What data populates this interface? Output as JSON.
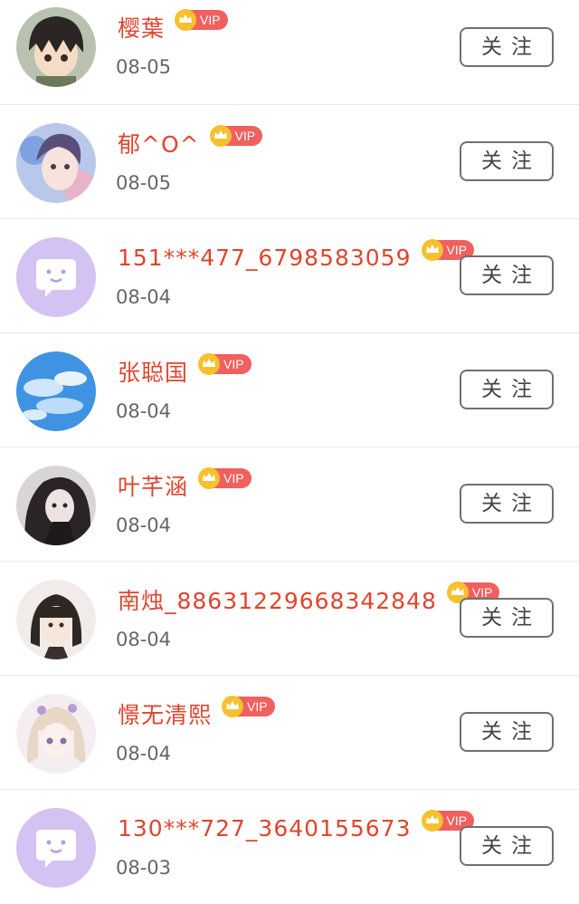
{
  "follow_label": "关注",
  "vip_label": "VIP",
  "colors": {
    "name": "#e0452e",
    "vip_badge": "#f0605e",
    "date": "#666666",
    "button_border": "#707070"
  },
  "users": [
    {
      "name": "樱葉",
      "date": "08-05",
      "avatar": "anime-boy-avatar"
    },
    {
      "name": "郁^O^",
      "date": "08-05",
      "avatar": "fantasy-girl-avatar"
    },
    {
      "name": "151***477_6798583059",
      "date": "08-04",
      "avatar": "default-chat-avatar"
    },
    {
      "name": "张聪国",
      "date": "08-04",
      "avatar": "sky-clouds-avatar"
    },
    {
      "name": "叶芊涵",
      "date": "08-04",
      "avatar": "girl-photo-avatar"
    },
    {
      "name": "南烛_88631229668342848",
      "date": "08-04",
      "avatar": "short-hair-girl-avatar"
    },
    {
      "name": "憬无清熙",
      "date": "08-04",
      "avatar": "anime-girl-avatar"
    },
    {
      "name": "130***727_3640155673",
      "date": "08-03",
      "avatar": "default-chat-avatar"
    }
  ]
}
